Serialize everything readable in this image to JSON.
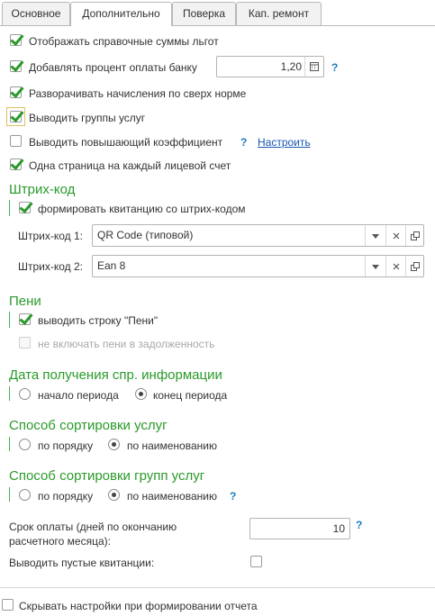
{
  "tabs": [
    "Основное",
    "Дополнительно",
    "Поверка",
    "Кап. ремонт"
  ],
  "options": {
    "show_benefit_sums": "Отображать справочные суммы льгот",
    "add_bank_percent": "Добавлять процент оплаты банку",
    "bank_percent_value": "1,20",
    "expand_over_norm": "Разворачивать начисления по сверх норме",
    "show_service_groups": "Выводить группы услуг",
    "show_raising_coef": "Выводить повышающий коэффициент",
    "configure_link": "Настроить",
    "one_page_per_account": "Одна страница на каждый лицевой счет",
    "help_mark": "?"
  },
  "barcode": {
    "title": "Штрих-код",
    "form_with_barcode": "формировать квитанцию со штрих-кодом",
    "code1_label": "Штрих-код 1:",
    "code1_value": "QR Code (типовой)",
    "code2_label": "Штрих-код 2:",
    "code2_value": "Ean 8"
  },
  "penalty": {
    "title": "Пени",
    "show_line": "выводить строку \"Пени\"",
    "exclude_from_debt": "не включать пени в задолженность"
  },
  "info_date": {
    "title": "Дата получения спр. информации",
    "opt1": "начало периода",
    "opt2": "конец периода"
  },
  "sort_services": {
    "title": "Способ сортировки услуг",
    "opt1": "по порядку",
    "opt2": "по наименованию"
  },
  "sort_groups": {
    "title": "Способ сортировки групп услуг",
    "opt1": "по порядку",
    "opt2": "по наименованию"
  },
  "payment_term": {
    "label": "Срок оплаты (дней по окончанию расчетного месяца):",
    "value": "10"
  },
  "empty_receipts": "Выводить пустые квитанции:",
  "hide_settings": "Скрывать настройки при формировании отчета",
  "icons": [
    "calendar-icon",
    "dropdown-arrow-icon",
    "clear-icon",
    "open-icon",
    "check-icon",
    "radio-icon"
  ],
  "colors": {
    "accent_green": "#2a9a2a",
    "link_blue": "#1a55b0",
    "help_blue": "#1a7bc0"
  }
}
